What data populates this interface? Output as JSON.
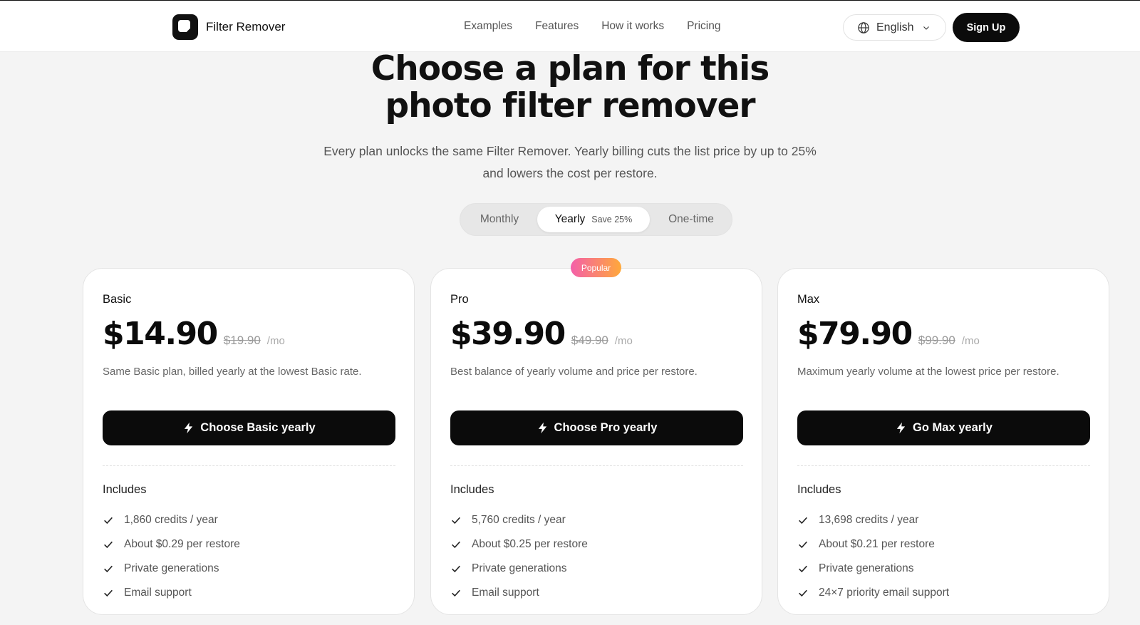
{
  "header": {
    "brand": "Filter Remover",
    "nav": [
      "Examples",
      "Features",
      "How it works",
      "Pricing"
    ],
    "language": "English",
    "signup_label": "Sign Up"
  },
  "hero": {
    "title_line1": "Choose a plan for this",
    "title_line2": "photo filter remover",
    "subtitle": "Every plan unlocks the same Filter Remover. Yearly billing cuts the list price by up to 25% and lowers the cost per restore."
  },
  "billing_toggle": {
    "monthly": "Monthly",
    "yearly": "Yearly",
    "yearly_tag": "Save 25%",
    "one_time": "One-time",
    "selected": "Yearly"
  },
  "popular_badge": "Popular",
  "plans": [
    {
      "name": "Basic",
      "price": "$14.90",
      "old_price": "$19.90",
      "period": "/mo",
      "description": "Same Basic plan, billed yearly at the lowest Basic rate.",
      "cta": "Choose Basic yearly",
      "includes_label": "Includes",
      "features": [
        "1,860 credits / year",
        "About $0.29 per restore",
        "Private generations",
        "Email support"
      ]
    },
    {
      "name": "Pro",
      "price": "$39.90",
      "old_price": "$49.90",
      "period": "/mo",
      "description": "Best balance of yearly volume and price per restore.",
      "cta": "Choose Pro yearly",
      "includes_label": "Includes",
      "features": [
        "5,760 credits / year",
        "About $0.25 per restore",
        "Private generations",
        "Email support"
      ]
    },
    {
      "name": "Max",
      "price": "$79.90",
      "old_price": "$99.90",
      "period": "/mo",
      "description": "Maximum yearly volume at the lowest price per restore.",
      "cta": "Go Max yearly",
      "includes_label": "Includes",
      "features": [
        "13,698 credits / year",
        "About $0.21 per restore",
        "Private generations",
        "24×7 priority email support"
      ]
    }
  ]
}
